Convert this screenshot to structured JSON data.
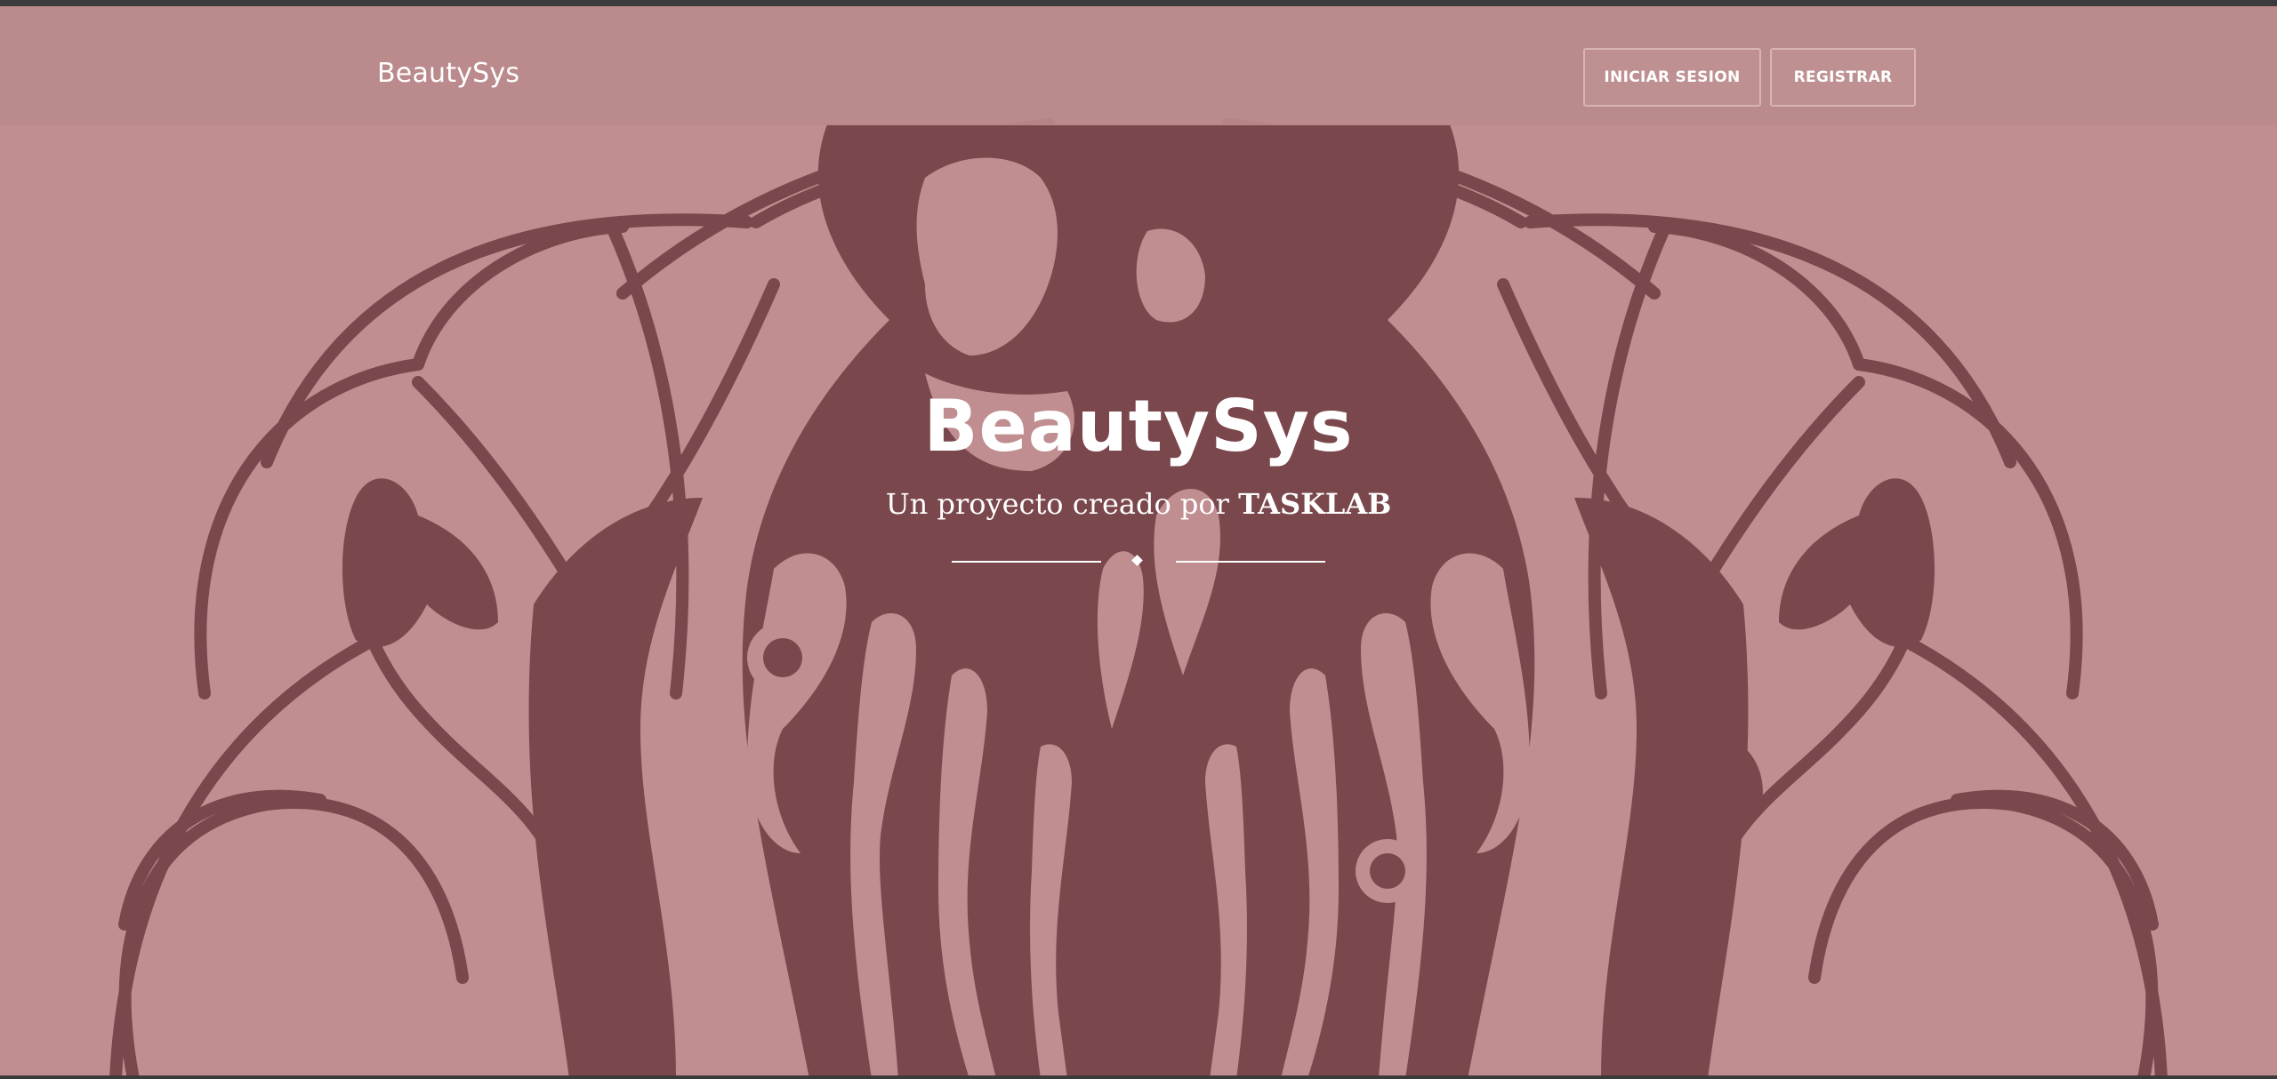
{
  "navbar": {
    "brand": "BeautySys",
    "login_label": "INICIAR SESION",
    "register_label": "REGISTRAR"
  },
  "hero": {
    "title": "BeautySys",
    "subtitle_prefix": "Un proyecto creado por",
    "subtitle_brand": "TASKLAB"
  },
  "colors": {
    "background": "#c08e90",
    "navbar": "#ba8a8c",
    "artwork": "#7a474c",
    "text": "#ffffff"
  },
  "icons": {
    "divider": "diamond-icon",
    "background_art": "woman-hair-illustration"
  }
}
